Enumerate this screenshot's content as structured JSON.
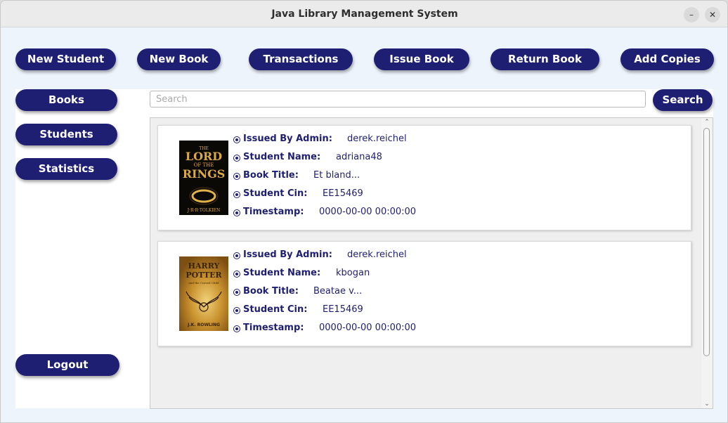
{
  "window": {
    "title": "Java Library Management System",
    "minimize_glyph": "–",
    "close_glyph": "✕"
  },
  "toolbar": {
    "new_student": "New Student",
    "new_book": "New Book",
    "transactions": "Transactions",
    "issue_book": "Issue Book",
    "return_book": "Return Book",
    "add_copies": "Add Copies"
  },
  "sidebar": {
    "books": "Books",
    "students": "Students",
    "statistics": "Statistics",
    "logout": "Logout"
  },
  "search": {
    "placeholder": "Search",
    "button": "Search"
  },
  "labels": {
    "issued_by": "Issued By Admin:",
    "student_name": "Student Name:",
    "book_title": "Book Title:",
    "student_cin": "Student Cin:",
    "timestamp": "Timestamp:"
  },
  "transactions": [
    {
      "issued_by": "derek.reichel",
      "student_name": "adriana48",
      "book_title": "Et bland...",
      "student_cin": "EE15469",
      "timestamp": "0000-00-00 00:00:00",
      "cover": {
        "line1": "THE",
        "line2": "LORD",
        "line3": "OF THE",
        "line4": "RINGS",
        "author": "J·R·R·TOLKIEN"
      }
    },
    {
      "issued_by": "derek.reichel",
      "student_name": "kbogan",
      "book_title": "Beatae v...",
      "student_cin": "EE15469",
      "timestamp": "0000-00-00 00:00:00",
      "cover": {
        "line1": "HARRY",
        "line2": "POTTER",
        "line3": "and the Cursed Child",
        "author": "J.K. ROWLING"
      }
    }
  ],
  "colors": {
    "button_bg": "#1e1f73",
    "window_bg": "#eef4fc",
    "text_accent": "#1e1f73"
  }
}
